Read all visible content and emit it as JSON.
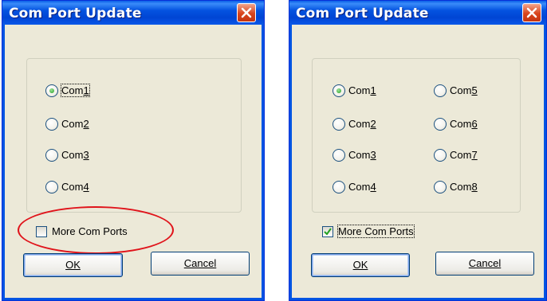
{
  "left_dialog": {
    "title": "Com Port Update",
    "radios": [
      {
        "label": "Com1",
        "mnemonic": "1",
        "selected": true
      },
      {
        "label": "Com2",
        "mnemonic": "2",
        "selected": false
      },
      {
        "label": "Com3",
        "mnemonic": "3",
        "selected": false
      },
      {
        "label": "Com4",
        "mnemonic": "4",
        "selected": false
      }
    ],
    "more_ports": {
      "label": "More Com Ports",
      "checked": false
    },
    "ok_label": "OK",
    "cancel_label": "Cancel"
  },
  "right_dialog": {
    "title": "Com Port Update",
    "radios": [
      {
        "label": "Com1",
        "mnemonic": "1",
        "selected": true
      },
      {
        "label": "Com2",
        "mnemonic": "2",
        "selected": false
      },
      {
        "label": "Com3",
        "mnemonic": "3",
        "selected": false
      },
      {
        "label": "Com4",
        "mnemonic": "4",
        "selected": false
      },
      {
        "label": "Com5",
        "mnemonic": "5",
        "selected": false
      },
      {
        "label": "Com6",
        "mnemonic": "6",
        "selected": false
      },
      {
        "label": "Com7",
        "mnemonic": "7",
        "selected": false
      },
      {
        "label": "Com8",
        "mnemonic": "8",
        "selected": false
      }
    ],
    "more_ports": {
      "label": "More Com Ports",
      "checked": true
    },
    "ok_label": "OK",
    "cancel_label": "Cancel"
  },
  "colors": {
    "title_bar": "#0054e3",
    "dialog_bg": "#ece9d8",
    "close_button": "#d9441c",
    "highlight": "#e0141b",
    "radio_dot": "#21a121"
  },
  "icons": [
    "close-icon",
    "checkmark-icon"
  ]
}
